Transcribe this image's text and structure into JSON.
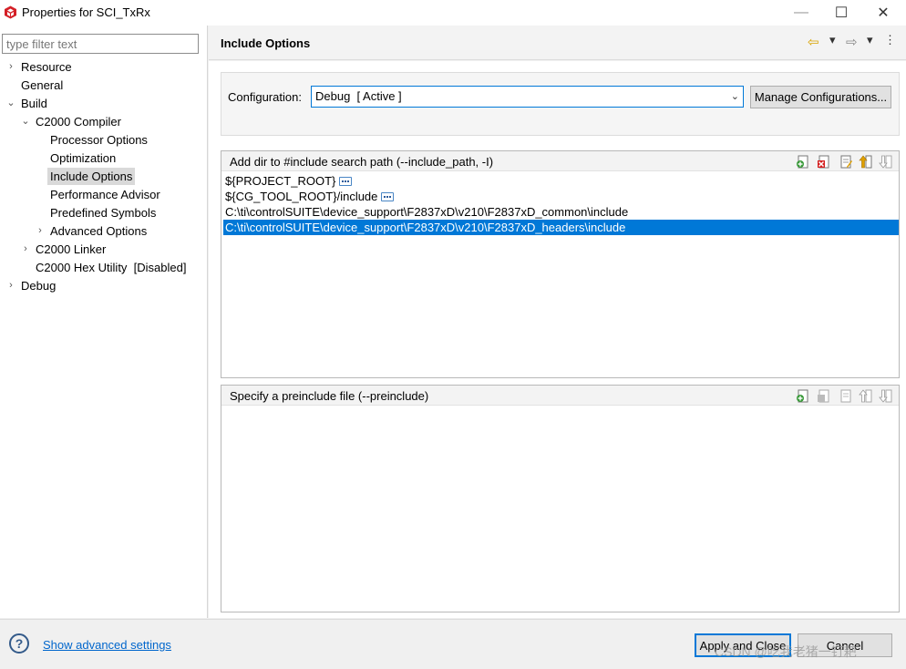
{
  "window": {
    "title": "Properties for SCI_TxRx",
    "minimize": "—",
    "maximize": "☐",
    "close": "✕"
  },
  "filter": {
    "placeholder": "type filter text",
    "value": ""
  },
  "tree": {
    "items": [
      {
        "label": "Resource",
        "expander": "›"
      },
      {
        "label": "General",
        "expander": ""
      },
      {
        "label": "Build",
        "expander": "⌄"
      },
      {
        "label": "C2000 Compiler",
        "expander": "⌄"
      },
      {
        "label": "Processor Options",
        "expander": ""
      },
      {
        "label": "Optimization",
        "expander": ""
      },
      {
        "label": "Include Options",
        "expander": "",
        "selected": true
      },
      {
        "label": "Performance Advisor",
        "expander": ""
      },
      {
        "label": "Predefined Symbols",
        "expander": ""
      },
      {
        "label": "Advanced Options",
        "expander": "›"
      },
      {
        "label": "C2000 Linker",
        "expander": "›"
      },
      {
        "label": "C2000 Hex Utility  [Disabled]",
        "expander": ""
      },
      {
        "label": "Debug",
        "expander": "›"
      }
    ]
  },
  "header": {
    "title": "Include Options",
    "back_icon": "⇦",
    "forward_icon": "⇨",
    "dropdown_icon": "▾",
    "menu_icon": "⋮"
  },
  "configuration": {
    "label": "Configuration:",
    "selected": "Debug  [ Active ]",
    "chevron": "⌄",
    "manage_button": "Manage Configurations..."
  },
  "include_paths": {
    "title": "Add dir to #include search path (--include_path, -I)",
    "items": [
      {
        "path": "${PROJECT_ROOT}",
        "has_more": true,
        "selected": false
      },
      {
        "path": "${CG_TOOL_ROOT}/include",
        "has_more": true,
        "selected": false
      },
      {
        "path": "C:\\ti\\controlSUITE\\device_support\\F2837xD\\v210\\F2837xD_common\\include",
        "has_more": false,
        "selected": false
      },
      {
        "path": "C:\\ti\\controlSUITE\\device_support\\F2837xD\\v210\\F2837xD_headers\\include",
        "has_more": false,
        "selected": true
      }
    ]
  },
  "preinclude": {
    "title": "Specify a preinclude file (--preinclude)",
    "items": []
  },
  "footer": {
    "help_icon": "?",
    "advanced_link": "Show advanced settings",
    "apply_button": "Apply and Close",
    "cancel_button": "Cancel",
    "watermark": "CSDN @吃我老猪一钉耙"
  },
  "colors": {
    "selection": "#0078d7",
    "link": "#0066cc",
    "app_icon": "#d42027"
  }
}
